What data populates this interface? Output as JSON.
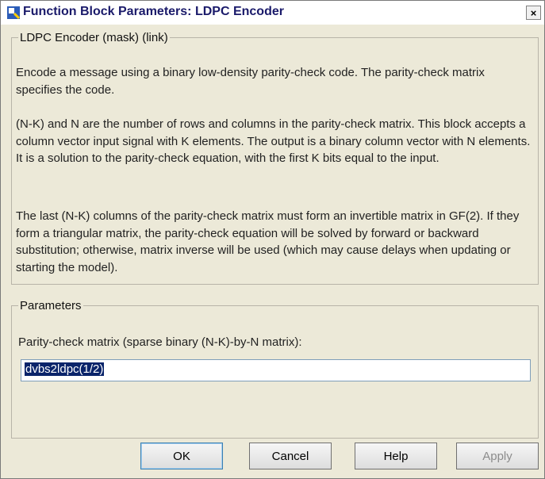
{
  "window": {
    "title": "Function Block Parameters: LDPC Encoder",
    "close_glyph": "×"
  },
  "group_description": {
    "legend": "LDPC Encoder (mask) (link)",
    "paragraphs": [
      "Encode a message using a binary low-density parity-check code. The parity-check matrix specifies the code.",
      "(N-K) and N are the number of rows and columns in the parity-check matrix. This block accepts a column vector input signal with K elements. The output is a binary column vector with N elements. It is a solution to the parity-check equation, with the first K bits equal to the input.",
      "The last (N-K) columns of the parity-check matrix must form an invertible matrix in GF(2). If they form a triangular matrix, the parity-check equation will be solved by forward or backward substitution; otherwise, matrix inverse will be used (which may cause delays when updating or starting the model)."
    ]
  },
  "group_parameters": {
    "legend": "Parameters",
    "parity_label": "Parity-check matrix (sparse binary (N-K)-by-N matrix):",
    "parity_value": "dvbs2ldpc(1/2)"
  },
  "buttons": {
    "ok": "OK",
    "cancel": "Cancel",
    "help": "Help",
    "apply": "Apply"
  },
  "colors": {
    "selection": "#0a246a",
    "disabled_text": "#8c8c8c"
  }
}
